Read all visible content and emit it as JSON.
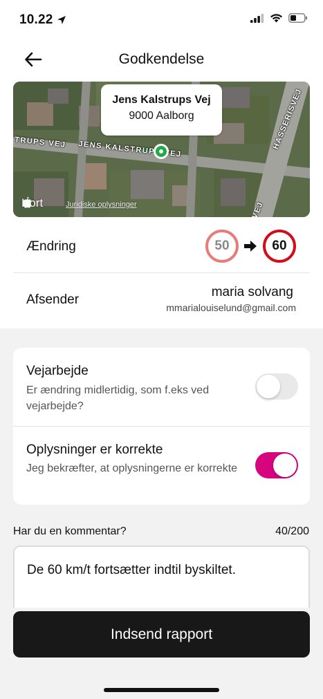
{
  "status_bar": {
    "time": "10.22",
    "location-icon": "location-arrow-icon",
    "icons": [
      "signal-icon",
      "wifi-icon",
      "battery-icon"
    ]
  },
  "nav": {
    "title": "Godkendelse",
    "back_icon": "arrow-left-icon"
  },
  "map": {
    "callout_street": "Jens Kalstrups Vej",
    "callout_city": "9000 Aalborg",
    "road_labels": [
      "TRUPS VEJ",
      "JENS KALSTRUPS VEJ",
      "HASSERISVEJ",
      "VEJ"
    ],
    "logo_text": "Kort",
    "legal_link": "Juridiske oplysninger",
    "pin_color": "#22a84a"
  },
  "change": {
    "label": "Ændring",
    "old_limit": "50",
    "new_limit": "60"
  },
  "sender": {
    "label": "Afsender",
    "name": "maria solvang",
    "email": "mmarialouiselund@gmail.com"
  },
  "settings": {
    "roadwork_title": "Vejarbejde",
    "roadwork_desc": "Er ændring midlertidig, som f.eks ved vejarbejde?",
    "roadwork_on": false,
    "correct_title": "Oplysninger er korrekte",
    "correct_desc": "Jeg bekræfter, at oplysningerne er korrekte",
    "correct_on": true
  },
  "comment": {
    "label": "Har du en kommentar?",
    "counter": "40/200",
    "text": "De 60 km/t fortsætter indtil byskiltet."
  },
  "submit_label": "Indsend rapport",
  "colors": {
    "accent": "#d6047f",
    "sign_red": "#d10d1b",
    "button_dark": "#181818"
  }
}
